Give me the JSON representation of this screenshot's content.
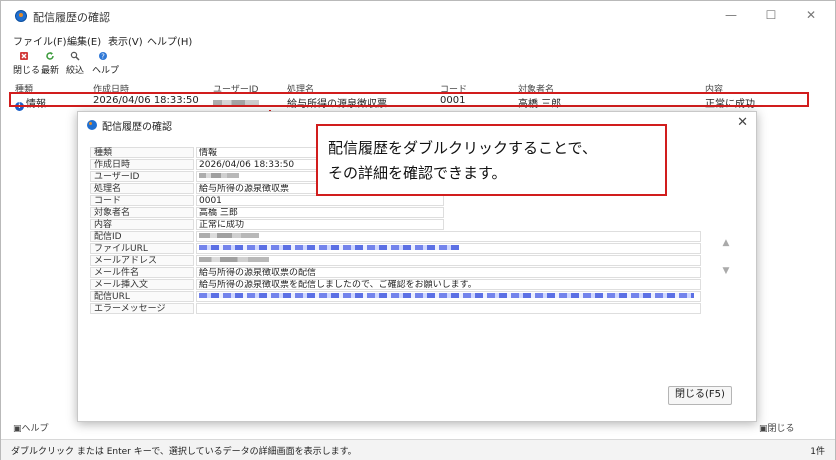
{
  "window": {
    "title": "配信履歴の確認",
    "minimize": "—",
    "maximize": "☐",
    "close": "✕"
  },
  "menu": [
    "ファイル(F)",
    "編集(E)",
    "表示(V)",
    "ヘルプ(H)"
  ],
  "toolbar": {
    "close_label": "閉じる",
    "refresh_label": "最新",
    "filter_label": "絞込",
    "help_label": "ヘルプ"
  },
  "list": {
    "headers": [
      "種類",
      "作成日時",
      "ユーザーID",
      "処理名",
      "コード",
      "対象者名",
      "内容"
    ],
    "row": {
      "type": "情報",
      "created": "2026/04/06 18:33:50",
      "process": "給与所得の源泉徴収票",
      "code": "0001",
      "target": "高橋 三郎",
      "content": "正常に成功"
    }
  },
  "dialog": {
    "title": "配信履歴の確認",
    "close": "✕",
    "fields": [
      {
        "label": "種類",
        "value": "情報"
      },
      {
        "label": "作成日時",
        "value": "2026/04/06 18:33:50"
      },
      {
        "label": "ユーザーID",
        "value": ""
      },
      {
        "label": "処理名",
        "value": "給与所得の源泉徴収票"
      },
      {
        "label": "コード",
        "value": "0001"
      },
      {
        "label": "対象者名",
        "value": "高橋 三郎"
      },
      {
        "label": "内容",
        "value": "正常に成功"
      },
      {
        "label": "配信ID",
        "value": ""
      },
      {
        "label": "ファイルURL",
        "value": ""
      },
      {
        "label": "メールアドレス",
        "value": ""
      },
      {
        "label": "メール件名",
        "value": "給与所得の源泉徴収票の配信"
      },
      {
        "label": "メール挿入文",
        "value": "給与所得の源泉徴収票を配信しましたので、ご確認をお願いします。"
      },
      {
        "label": "配信URL",
        "value": ""
      },
      {
        "label": "エラーメッセージ",
        "value": ""
      }
    ],
    "close_button": "閉じる(F5)"
  },
  "callout": {
    "line1": "配信履歴をダブルクリックすることで、",
    "line2": "その詳細を確認できます。"
  },
  "bottom": {
    "help": "ヘルプ",
    "close": "閉じる"
  },
  "status": {
    "text": "ダブルクリック または Enter キーで、選択しているデータの詳細画面を表示します。",
    "count": "1件"
  },
  "colors": {
    "highlight": "#d11d1d",
    "info": "#1a5fc8",
    "masked_link": "#3f57e0"
  },
  "icons": [
    "app-icon",
    "close-x-icon",
    "refresh-icon",
    "search-icon",
    "help-icon",
    "info-icon",
    "arrow-up-icon",
    "arrow-down-icon"
  ]
}
